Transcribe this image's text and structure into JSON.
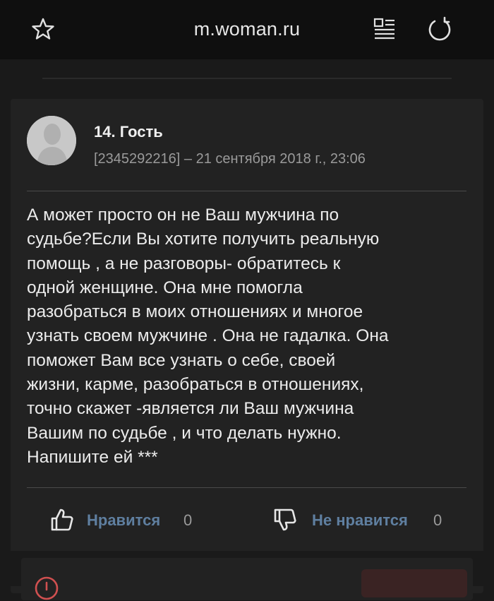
{
  "browser": {
    "url": "m.woman.ru"
  },
  "comment": {
    "author": "14. Гость",
    "meta": "[2345292216] – 21 сентября 2018 г., 23:06",
    "text": "А может просто он не Ваш мужчина по\nсудьбе?Если Вы хотите получить реальную\nпомощь , а не разговоры- обратитесь к\nодной женщине. Она мне помогла\nразобраться в моих отношениях и многое\nузнать своем мужчине . Она не гадалка. Она\nпоможет Вам все узнать о себе, своей\nжизни, карме, разобраться в отношениях,\nточно скажет -является ли Ваш мужчина\nВашим по судьбе , и что делать нужно.\nНапишите ей ***",
    "like_label": "Нравится",
    "like_count": "0",
    "dislike_label": "Не нравится",
    "dislike_count": "0"
  },
  "colors": {
    "background": "#1a1a1a",
    "card": "#222222",
    "topbar": "#0f0f0f",
    "vote_label": "#5f7fa0"
  },
  "icons": [
    "star-icon",
    "reader-mode-icon",
    "reload-icon",
    "thumbs-up-icon",
    "thumbs-down-icon",
    "warning-icon"
  ]
}
